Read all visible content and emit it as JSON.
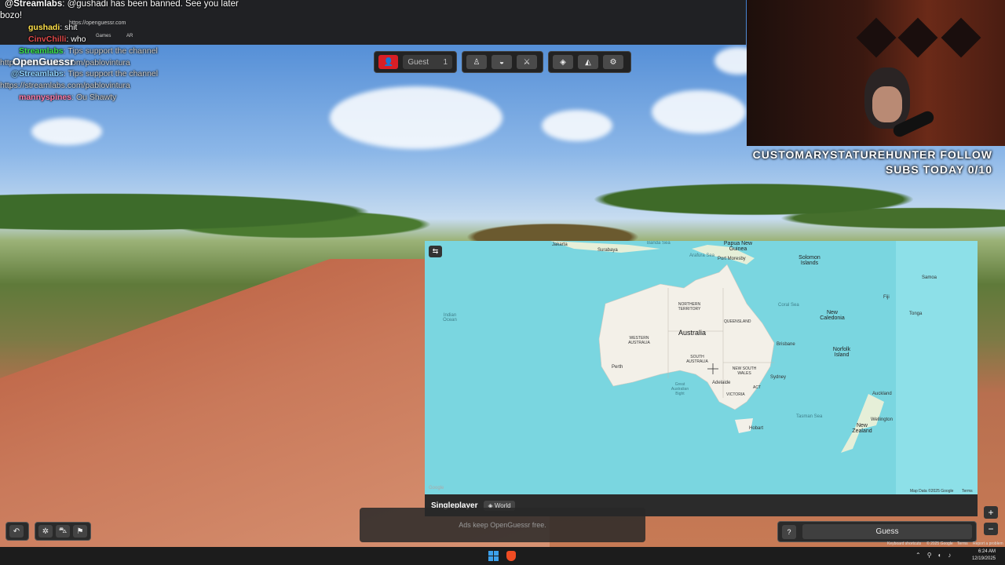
{
  "browser": {
    "url": "https://openguessr.com",
    "bookmarks": [
      "Games",
      "AR"
    ]
  },
  "chat": {
    "lines": [
      {
        "user": "@Streamlabs",
        "text": ": @gushadi has been banned. See you later",
        "color": "#ffffff"
      },
      {
        "user": "",
        "text": "bozo!",
        "color": "#ffffff"
      },
      {
        "user": "gushadi",
        "text": ": shit",
        "color": "#ffe14a"
      },
      {
        "user": "CinvChilli",
        "text": ": who",
        "color": "#e04a4a"
      },
      {
        "user": "Streamlabs",
        "text": ": Tips support the channel",
        "color": "#3be34a"
      },
      {
        "user": "",
        "text": "https://streamlabs.com/pablovintura",
        "color": "#ffffff"
      },
      {
        "user": "@Streamlabs",
        "text": ": Tips support the channel",
        "color": "#8fd3ff"
      },
      {
        "user": "",
        "text": "https://streamlabs.com/pablovintura",
        "color": "#ffffff"
      },
      {
        "user": "mannyspines",
        "text": ": Ou Shawty",
        "color": "#ff7ba8"
      }
    ],
    "logo": "OpenGuessr"
  },
  "toolbar": {
    "player_name": "Guest",
    "player_count": "1"
  },
  "stream": {
    "follow_line1": "CUSTOMARYSTATUREHUNTER FOLLOW",
    "follow_line2": "SUBS TODAY 0/10"
  },
  "map": {
    "labels": {
      "australia": "Australia",
      "northern_territory": "NORTHERN TERRITORY",
      "queensland": "QUEENSLAND",
      "western_australia": "WESTERN AUSTRALIA",
      "south_australia": "SOUTH AUSTRALIA",
      "new_south_wales": "NEW SOUTH WALES",
      "victoria": "VICTORIA",
      "act": "ACT",
      "perth": "Perth",
      "adelaide": "Adelaide",
      "sydney": "Sydney",
      "brisbane": "Brisbane",
      "hobart": "Hobart",
      "jakarta": "Jakarta",
      "surabaya": "Surabaya",
      "banda_sea": "Banda Sea",
      "arafura_sea": "Arafura Sea",
      "png": "Papua New Guinea",
      "port_moresby": "Port Moresby",
      "solomon": "Solomon Islands",
      "coral_sea": "Coral Sea",
      "new_caledonia": "New Caledonia",
      "norfolk": "Norfolk Island",
      "fiji": "Fiji",
      "samoa": "Samoa",
      "tonga": "Tonga",
      "indian_ocean": "Indian Ocean",
      "tasman_sea": "Tasman Sea",
      "new_zealand": "New Zealand",
      "auckland": "Auckland",
      "wellington": "Wellington",
      "great_australian_bight": "Great Australian Bight",
      "google": "Google",
      "map_data": "Map Data ©2025 Google",
      "terms": "Terms"
    },
    "mode": "Singleplayer",
    "region": "World"
  },
  "ads_text": "Ads keep OpenGuessr free.",
  "guess": {
    "help": "?",
    "label": "Guess"
  },
  "zoom": {
    "in": "+",
    "out": "−"
  },
  "google_footer": [
    "Keyboard shortcuts",
    "© 2025 Google",
    "Terms",
    "Report a problem"
  ],
  "taskbar": {
    "time": "6:24 AM",
    "date": "12/19/2025"
  },
  "icons": {
    "back": "↶",
    "flag": "⚑"
  }
}
